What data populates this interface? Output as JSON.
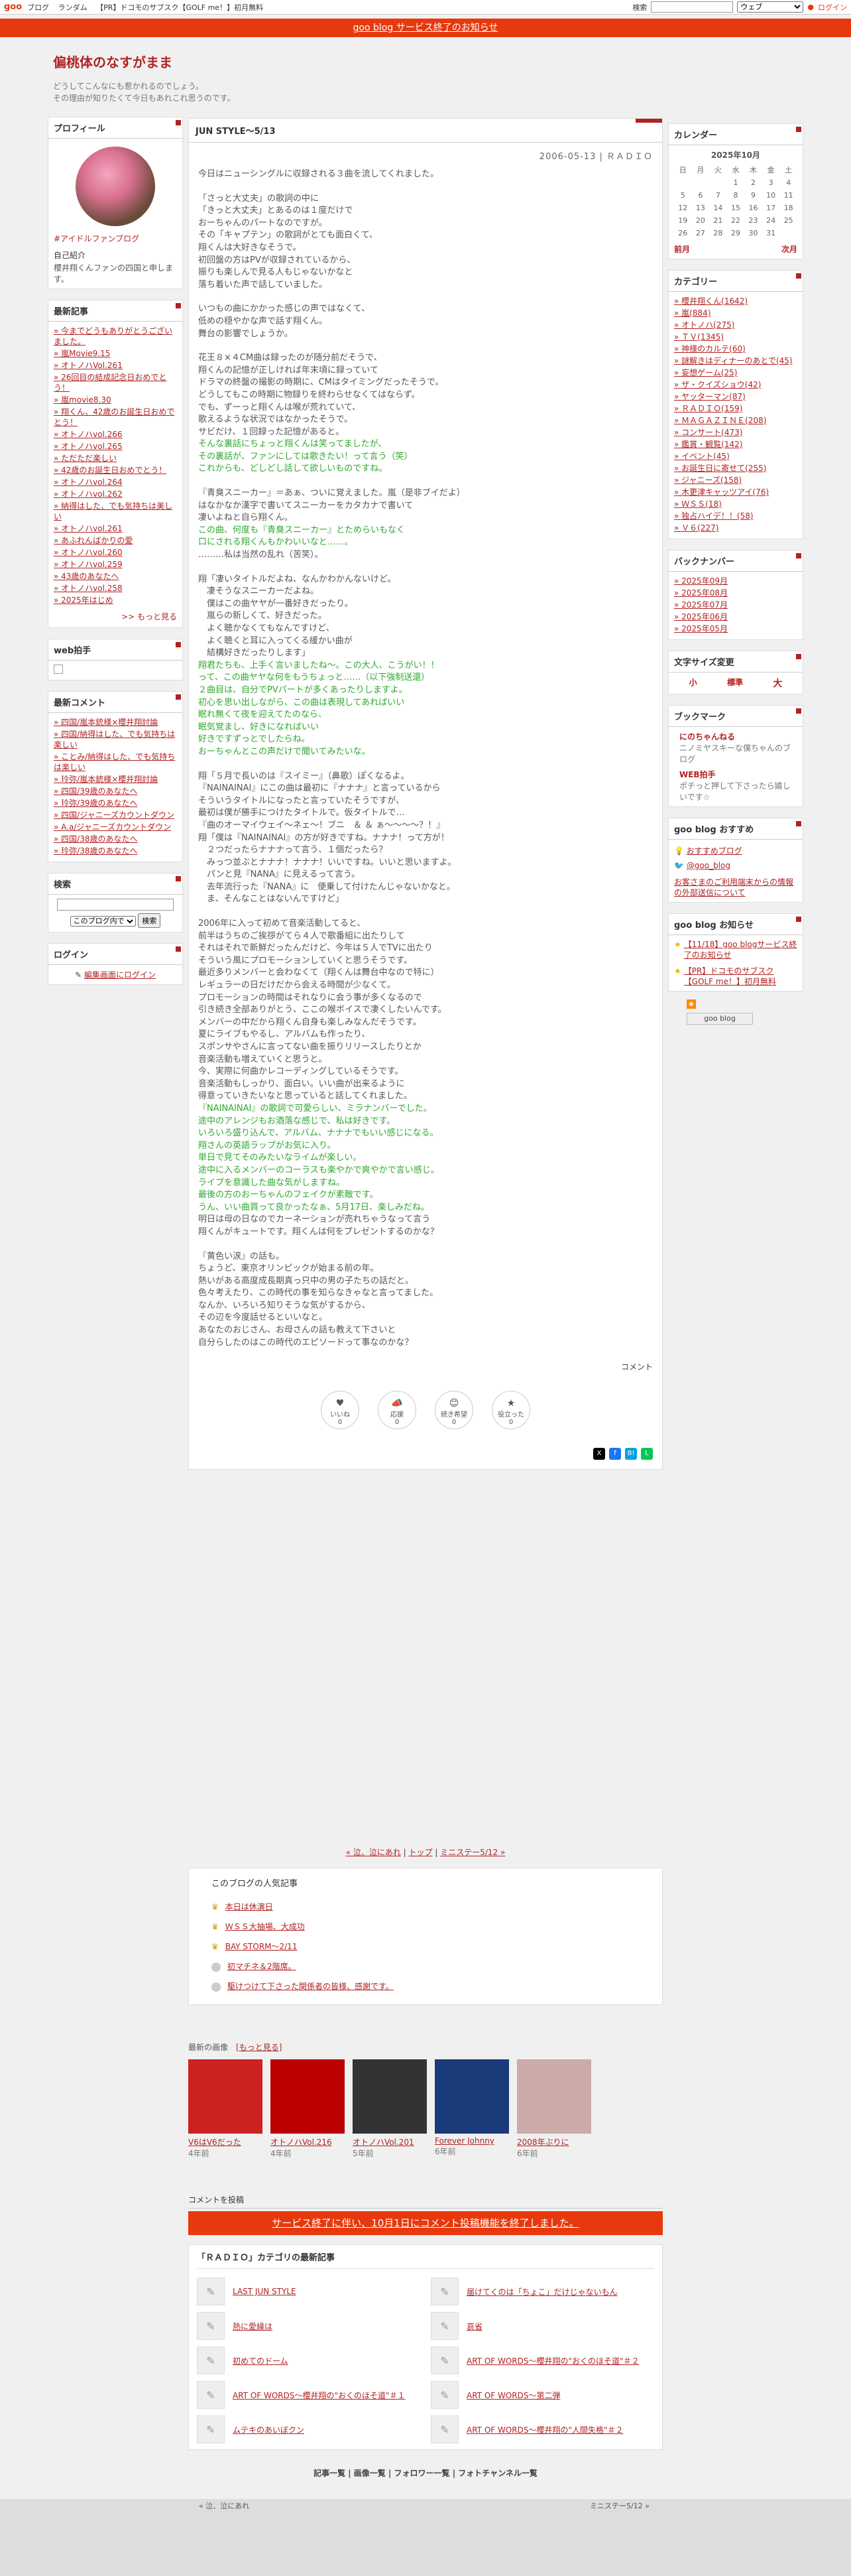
{
  "topbar": {
    "logo": "goo",
    "nav": [
      "ブログ",
      "ランダム",
      "【PR】ドコモのサブスク【GOLF me！】初月無料"
    ],
    "search_label": "検索",
    "engine": "ウェブ",
    "login": "ログイン"
  },
  "notice": {
    "text": "goo blog サービス終了のお知らせ"
  },
  "blog": {
    "title": "偏桃体のなすがまま",
    "desc_line1": "どうしてこんなにも惹かれるのでしょう。",
    "desc_line2": "その理由が知りたくて今日もあれこれ思うのです。"
  },
  "profile": {
    "heading": "プロフィール",
    "tag": "#アイドルファンブログ",
    "intro_title": "自己紹介",
    "intro": "櫻井翔くんファンの四国と申します。"
  },
  "recent_articles": {
    "heading": "最新記事",
    "items": [
      "今までどうもありがとうございました。",
      "嵐Movie9.15",
      "オトノハVol.261",
      "26回目の結成記念日おめでとう！",
      "嵐movie8.30",
      "翔くん、42歳のお誕生日おめでとう！",
      "オトノハvol.266",
      "オトノハvol.265",
      "ただただ楽しい",
      "42歳のお誕生日おめでとう！",
      "オトノハvol.264",
      "オトノハvol.262",
      "納得はした、でも気持ちは美しい",
      "オトノハvol.261",
      "あふれんばかりの愛",
      "オトノハvol.260",
      "オトノハvol.259",
      "43歳のあなたへ",
      "オトノハvol.258",
      "2025年はじめ"
    ],
    "more": ">> もっと見る"
  },
  "web_ad": {
    "heading": "web拍手"
  },
  "recent_comments": {
    "heading": "最新コメント",
    "items": [
      "四国/嵐本銃様×櫻井翔討論",
      "四国/納得はした、でも気持ちは楽しい",
      "ことみ/納得はした、でも気持ちは楽しい",
      "玲弥/嵐本銃様×櫻井翔討論",
      "四国/39歳のあなたへ",
      "玲弥/39歳のあなたへ",
      "四国/ジャニーズカウントダウン",
      "A.a/ジャニーズカウントダウン",
      "四国/38歳のあなたへ",
      "玲弥/38歳のあなたへ"
    ]
  },
  "search_box": {
    "heading": "検索",
    "scope": "このブログ内で",
    "button": "検索"
  },
  "login_box": {
    "heading": "ログイン",
    "link": "編集画面にログイン"
  },
  "calendar": {
    "heading": "カレンダー",
    "month": "2025年10月",
    "days": [
      "日",
      "月",
      "火",
      "水",
      "木",
      "金",
      "土"
    ],
    "rows": [
      [
        "",
        "",
        "",
        "1",
        "2",
        "3",
        "4"
      ],
      [
        "5",
        "6",
        "7",
        "8",
        "9",
        "10",
        "11"
      ],
      [
        "12",
        "13",
        "14",
        "15",
        "16",
        "17",
        "18"
      ],
      [
        "19",
        "20",
        "21",
        "22",
        "23",
        "24",
        "25"
      ],
      [
        "26",
        "27",
        "28",
        "29",
        "30",
        "31",
        ""
      ]
    ],
    "prev": "前月",
    "next": "次月"
  },
  "categories": {
    "heading": "カテゴリー",
    "items": [
      "櫻井翔くん(1642)",
      "嵐(884)",
      "オトノハ(275)",
      "ＴＶ(1345)",
      "神様のカルテ(60)",
      "謎解きはディナーのあとで(45)",
      "妄想ゲーム(25)",
      "ザ・クイズショウ(42)",
      "ヤッターマン(87)",
      "ＲＡＤＩＯ(159)",
      "ＭＡＧＡＺＩＮＥ(208)",
      "コンサート(473)",
      "鑑賞・観覧(142)",
      "イベント(45)",
      "お誕生日に寄せて(255)",
      "ジャニーズ(158)",
      "木更津キャッツアイ(76)",
      "ＷＳＳ(18)",
      "独占ハイデ！！(58)",
      "Ｖ６(227)"
    ]
  },
  "backnumber": {
    "heading": "バックナンバー",
    "items": [
      "2025年09月",
      "2025年08月",
      "2025年07月",
      "2025年06月",
      "2025年05月"
    ]
  },
  "fontsize": {
    "heading": "文字サイズ変更",
    "small": "小",
    "normal": "標準",
    "large": "大"
  },
  "bookmark": {
    "heading": "ブックマーク",
    "b1_title": "にのちゃんねる",
    "b1_desc": "ニノミヤスキーな僕ちゃんのブログ",
    "b2_title": "WEB拍手",
    "b2_desc": "ポチっと押して下さったら嬉しいです☆"
  },
  "goo_rec": {
    "heading": "goo blog おすすめ",
    "item1": "おすすめブログ",
    "item2": "@goo_blog",
    "notice": "お客さまのご利用端末からの情報の外部送信について"
  },
  "goo_news": {
    "heading": "goo blog お知らせ",
    "item1": "【11/18】goo blogサービス終了のお知らせ",
    "item2": "【PR】ドコモのサブスク【GOLF me！】初月無料",
    "badge": "goo blog"
  },
  "article": {
    "title": "JUN STYLE～5/13",
    "meta": "2006-05-13 | ＲＡＤＩＯ",
    "p1": "今日はニューシングルに収録される３曲を流してくれました。",
    "p2": "「さっと大丈夫」の歌詞の中に\n「きっと大丈夫」とあるのは１度だけで\nおーちゃんのパートなのですが。\nその「キャプテン」の歌詞がとても面白くて、\n翔くんは大好きなそうで。\n初回盤の方はPVが収録されているから、\n振りも楽しんで見る人もじゃないかなと\n落ち着いた声で話していました。",
    "p3": "いつもの曲にかかった感じの声ではなくて、\n低めの穏やかな声で話す翔くん。\n舞台の影響でしょうか。",
    "p4": "花王８×４CM曲は録ったのが随分前だそうで、\n翔くんの記憶が正しければ年末頃に録っていて\nドラマの終盤の撮影の時期に、CMはタイミングだったそうで。\nどうしてもこの時期に物録りを終わらせなくてはならず。\nでも、ずーっと翔くんは喉が荒れていて、\n歌えるような状況ではなかったそうで。\nサビだけ、１回録った記憶があると。",
    "p4g": "そんな裏話にちょっと翔くんは笑ってましたが、\nその裏話が、ファンにしては歌きたい！って言う（笑）\nこれからも、どしどし話して欲しいものですね。",
    "p5": "『青臭スニーカー』＝あぁ、ついに覚えました。嵐（是非ブイだよ）\nはなかなか漢字で書いてスニーカーをカタカナで書いて\n凄いよねと自ら翔くん。",
    "p5g": "この曲、何度も『青臭スニーカー』とためらいもなく\n口にされる翔くんもかわいいなと……。",
    "p5b": "………私は当然の乱れ（苦笑）。",
    "p6": "翔「凄いタイトルだよね、なんかわかんないけど。\n　凄そうなスニーカーだよね。\n　僕はこの曲ヤヤが一番好きだったり。\n　嵐らの新しくて、好きだった。\n　よく聴かなくてもなんですけど、\n　よく聴くと耳に入ってくる緩かい曲が\n　結構好きだったりします」",
    "p6g": "翔君たちも、上手く言いましたね～。この大人、こうがい！！\nって、この曲ヤヤな何をもうちょっと……（以下強制送還）\n２曲目は、自分でPVパートが多くあったりしますよ。\n初心を思い出しながら、この曲は表現してあればいい\n眠れ無くて夜を迎えてたのなら、\n眠気覚まし、好きになればいい\n好きですずっとでしたらね。\nおーちゃんとこの声だけで聞いてみたいな。",
    "p7": "翔「５月で長いのは『スイミー』（鼻歌）ぽくなるよ。\n『NAINAINAI』にこの曲は最初に『ナナナ』と言っているから\nそういうタイトルになったと言っていたそうですが、\n最初は僕が勝手につけたタイトルで。仮タイトルで…\n『曲のオーマイウェイ～ネェ～！ブニ　＆ ＆ ぁ～～～～？！』\n翔「僕は『NAINAINAI』の方が好きですね。ナナナ！って方が！\n　２つだったらナナナって言う、１個だったら？\n　みっつ並ぶとナナナ！ナナナ！いいですね。いいと思いますよ。\n　パンと見『NANA』に見えるって言う。\n　去年流行った『NANA』に　便乗して付けたんじゃないかなと。\n　ま、そんなことはないんですけど」",
    "p8": "2006年に入って初めて音楽活動してると、\n前半はうちのご挨拶がてら４人で歌番組に出たりして\nそれはそれで新鮮だったんだけど、今年は５人でTVに出たり\nそういう風にプロモーションしていくと思うそうです。\n最近多りメンバーと会わなくて（翔くんは舞台中なので特に）\nレギュラーの日だけだから会える時間が少なくて。\nプロモーションの時間はそれなりに会う事が多くなるので\n引き続き全部ありがとう、ここの喉ボイスで凄くしたいんです。\nメンバーの中だから翔くん自身も楽しみなんだそうです。\n夏にライブもやるし、アルバムも作ったり、\nスポンサやさんに言ってない曲を振りリリースしたりとか\n音楽活動も増えていくと思うと。\n今、実際に何曲かレコーディングしているそうです。\n音楽活動もしっかり、面白い。いい曲が出来るように\n得意っていきたいなと思っていると話してくれました。",
    "p8g": "『NAINAINAI』の歌詞で可愛らしい、ミラナンバーでした。\n途中のアレンジもお酒落な感じで、私は好きです。\nいろいろ盛り込んで、アルバム、ナナナでもいい感じになる。\n翔さんの英語ラップがお気に入り。\n単日で見てそのみたいなライムが楽しい。\n途中に入るメンバーのコーラスも楽やかで爽やかで言い感じ。\nライブを意識した曲な気がしますね。\n最後の方のおーちゃんのフェイクが素敵です。\nうん、いい曲買って良かったなぁ、5月17日、楽しみだね。",
    "p8b": "明日は母の日なのでカーネーションが売れちゃうなって言う\n翔くんがキュートです。翔くんは何をプレゼントするのかな？",
    "p9": "『黄色い涙』の話も。\nちょうど、東京オリンピックが始まる前の年。\n熱いがある高度成長期真っ只中の男の子たちの話だと。\n色々考えたり、この時代の事を知らなきゃなと言ってました。\nなんか、いろいろ知りそうな気がするから、\nその辺を今度話せるといいなと。\nあなたのおじさん、お母さんの話も教えて下さいと\n自分らしたのはこの時代のエピソードって事なのかな？",
    "comment_link": "コメント"
  },
  "reactions": [
    {
      "icon": "♥",
      "label": "いいね",
      "count": "0"
    },
    {
      "icon": "📣",
      "label": "応援",
      "count": "0"
    },
    {
      "icon": "😊",
      "label": "続き希望",
      "count": "0"
    },
    {
      "icon": "★",
      "label": "役立った",
      "count": "0"
    }
  ],
  "pager": {
    "prev": "« 泣、泣にあれ",
    "top": "トップ",
    "next": "ミニステー5/12 »"
  },
  "popular": {
    "heading": "このブログの人気記事",
    "items": [
      "本日は休演日",
      "ＷＳＳ大抽場、大成功",
      "BAY STORM～2/11",
      "初マチネ＆2階席。",
      "駆けつけて下さった関係者の皆様、感謝です。"
    ]
  },
  "recent_images": {
    "heading": "最新の画像",
    "more": "[もっと見る]",
    "items": [
      {
        "title": "V6はV6だった",
        "ago": "4年前",
        "color": "#c22"
      },
      {
        "title": "オトノハVol.216",
        "ago": "4年前",
        "color": "#b00"
      },
      {
        "title": "オトノハVol.201",
        "ago": "5年前",
        "color": "#333"
      },
      {
        "title": "Forever Johnny",
        "ago": "6年前",
        "color": "#1b3a7a"
      },
      {
        "title": "2008年ぶりに",
        "ago": "6年前",
        "color": "#caa"
      }
    ]
  },
  "comment_post": {
    "heading": "コメントを投稿",
    "closed": "サービス終了に伴い、10月1日にコメント投稿機能を終了しました。"
  },
  "category_recent": {
    "heading": "「ＲＡＤＩＯ」カテゴリの最新記事",
    "items": [
      "LAST JUN STYLE",
      "届けてくのは「ちょこ」だけじゃないもん",
      "熱に愛繰は",
      "哀省",
      "初めてのドーム",
      "ART OF WORDS～櫻井翔の\"おくのほそ道\"＃２",
      "ART OF WORDS～櫻井翔の\"おくのほそ道\"＃１",
      "ART OF WORDS～第二弾",
      "ムテキのあいぼクン",
      "ART OF WORDS～櫻井翔の\"人間失格\"＃２"
    ]
  },
  "footer": {
    "links": "記事一覧 | 画像一覧 | フォロワー一覧 | フォトチャンネル一覧"
  },
  "footer_mini": {
    "prev": "« 泣、泣にあれ",
    "next": "ミニステー5/12 »"
  }
}
